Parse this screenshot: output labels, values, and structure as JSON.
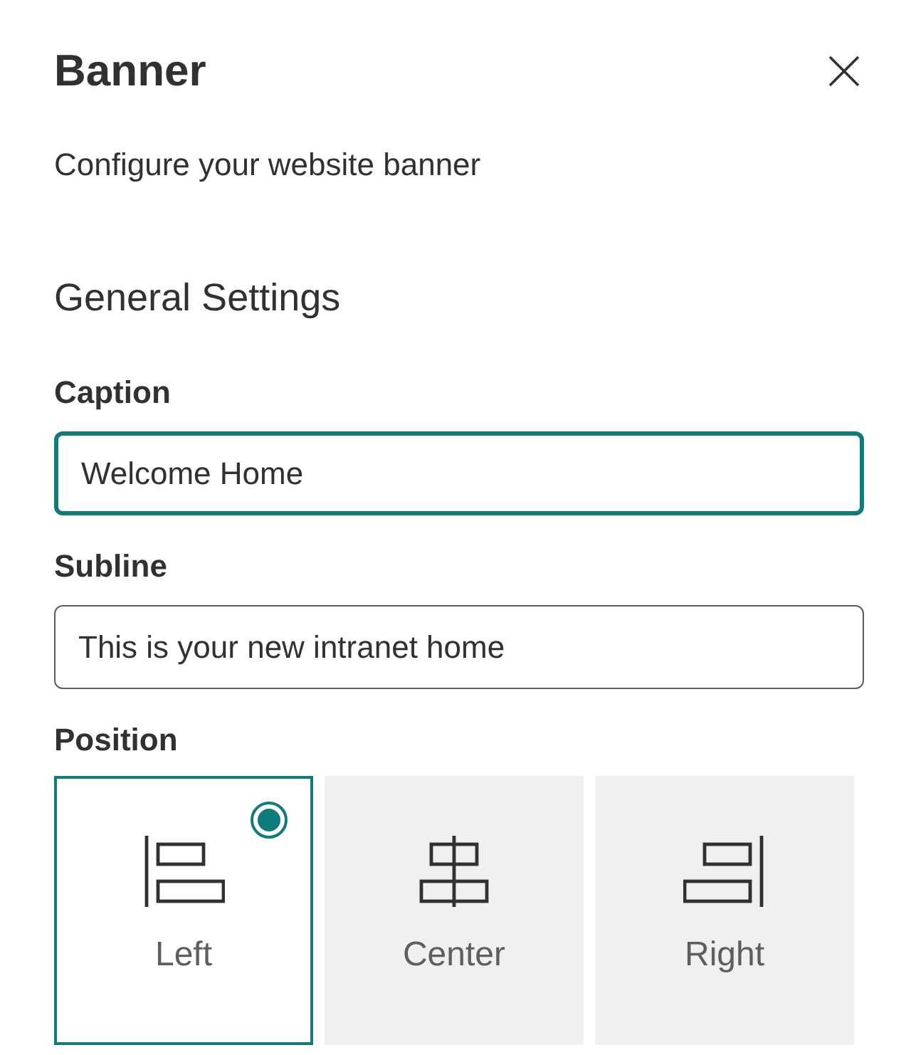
{
  "panel": {
    "title": "Banner",
    "description": "Configure your website banner"
  },
  "section": {
    "heading": "General Settings"
  },
  "fields": [
    {
      "label": "Caption",
      "value": "Welcome Home",
      "focused": true
    },
    {
      "label": "Subline",
      "value": "This is your new intranet home",
      "focused": false
    }
  ],
  "position": {
    "label": "Position",
    "options": [
      {
        "kind": "left",
        "label": "Left",
        "selected": true
      },
      {
        "kind": "center",
        "label": "Center",
        "selected": false
      },
      {
        "kind": "right",
        "label": "Right",
        "selected": false
      }
    ]
  }
}
